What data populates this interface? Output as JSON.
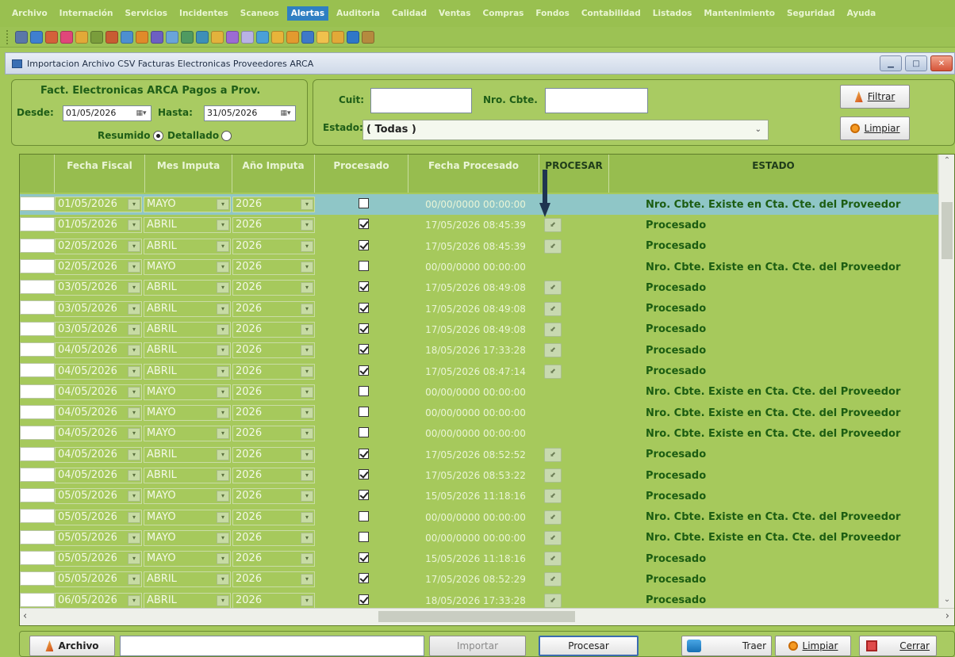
{
  "menu": {
    "items": [
      "Archivo",
      "Internación",
      "Servicios",
      "Incidentes",
      "Scaneos",
      "Alertas",
      "Auditoria",
      "Calidad",
      "Ventas",
      "Compras",
      "Fondos",
      "Contabilidad",
      "Listados",
      "Mantenimiento",
      "Seguridad",
      "Ayuda"
    ],
    "active": "Alertas"
  },
  "toolbar": {
    "icons": [
      "print-icon",
      "document-icon",
      "users-icon",
      "heart-icon",
      "home-icon",
      "grid-icon",
      "chart-icon",
      "report-icon",
      "gear-icon",
      "form-icon",
      "calculator-icon",
      "list-icon",
      "table-icon",
      "pencil-icon",
      "wand-icon",
      "wand-icon",
      "link-icon",
      "folder-icon",
      "alert-icon",
      "refresh-icon",
      "folder-icon",
      "refresh-icon",
      "search-icon",
      "exit-icon"
    ]
  },
  "window": {
    "title": "Importacion Archivo CSV Facturas Electronicas Proveedores ARCA"
  },
  "date_filter": {
    "title": "Fact. Electronicas ARCA Pagos a Prov.",
    "desde_label": "Desde:",
    "desde_value": "01/05/2026",
    "hasta_label": "Hasta:",
    "hasta_value": "31/05/2026",
    "resumido_label": "Resumido",
    "detallado_label": "Detallado",
    "mode": "Resumido"
  },
  "search": {
    "cuit_label": "Cuit:",
    "cuit_value": "",
    "nrocbte_label": "Nro. Cbte.",
    "nrocbte_value": "",
    "estado_label": "Estado:",
    "estado_value": "( Todas )",
    "filtrar_label": "Filtrar",
    "limpiar_label": "Limpiar"
  },
  "grid": {
    "columns": [
      "Fecha Fiscal",
      "Mes Imputa",
      "Año Imputa",
      "Procesado",
      "Fecha Procesado",
      "PROCESAR",
      "ESTADO"
    ],
    "rows": [
      {
        "fecha": "01/05/2026",
        "mes": "MAYO",
        "anio": "2026",
        "procesado": false,
        "fecha_proc": "00/00/0000 00:00:00",
        "procesar": false,
        "estado": "Nro. Cbte. Existe en Cta. Cte. del Proveedor",
        "selected": true
      },
      {
        "fecha": "01/05/2026",
        "mes": "ABRIL",
        "anio": "2026",
        "procesado": true,
        "fecha_proc": "17/05/2026 08:45:39",
        "procesar": true,
        "estado": "Procesado"
      },
      {
        "fecha": "02/05/2026",
        "mes": "ABRIL",
        "anio": "2026",
        "procesado": true,
        "fecha_proc": "17/05/2026 08:45:39",
        "procesar": true,
        "estado": "Procesado"
      },
      {
        "fecha": "02/05/2026",
        "mes": "MAYO",
        "anio": "2026",
        "procesado": false,
        "fecha_proc": "00/00/0000 00:00:00",
        "procesar": false,
        "estado": "Nro. Cbte. Existe en Cta. Cte. del Proveedor"
      },
      {
        "fecha": "03/05/2026",
        "mes": "ABRIL",
        "anio": "2026",
        "procesado": true,
        "fecha_proc": "17/05/2026 08:49:08",
        "procesar": true,
        "estado": "Procesado"
      },
      {
        "fecha": "03/05/2026",
        "mes": "ABRIL",
        "anio": "2026",
        "procesado": true,
        "fecha_proc": "17/05/2026 08:49:08",
        "procesar": true,
        "estado": "Procesado"
      },
      {
        "fecha": "03/05/2026",
        "mes": "ABRIL",
        "anio": "2026",
        "procesado": true,
        "fecha_proc": "17/05/2026 08:49:08",
        "procesar": true,
        "estado": "Procesado"
      },
      {
        "fecha": "04/05/2026",
        "mes": "ABRIL",
        "anio": "2026",
        "procesado": true,
        "fecha_proc": "18/05/2026 17:33:28",
        "procesar": true,
        "estado": "Procesado"
      },
      {
        "fecha": "04/05/2026",
        "mes": "ABRIL",
        "anio": "2026",
        "procesado": true,
        "fecha_proc": "17/05/2026 08:47:14",
        "procesar": true,
        "estado": "Procesado"
      },
      {
        "fecha": "04/05/2026",
        "mes": "MAYO",
        "anio": "2026",
        "procesado": false,
        "fecha_proc": "00/00/0000 00:00:00",
        "procesar": false,
        "estado": "Nro. Cbte. Existe en Cta. Cte. del Proveedor"
      },
      {
        "fecha": "04/05/2026",
        "mes": "MAYO",
        "anio": "2026",
        "procesado": false,
        "fecha_proc": "00/00/0000 00:00:00",
        "procesar": false,
        "estado": "Nro. Cbte. Existe en Cta. Cte. del Proveedor"
      },
      {
        "fecha": "04/05/2026",
        "mes": "MAYO",
        "anio": "2026",
        "procesado": false,
        "fecha_proc": "00/00/0000 00:00:00",
        "procesar": false,
        "estado": "Nro. Cbte. Existe en Cta. Cte. del Proveedor"
      },
      {
        "fecha": "04/05/2026",
        "mes": "ABRIL",
        "anio": "2026",
        "procesado": true,
        "fecha_proc": "17/05/2026 08:52:52",
        "procesar": true,
        "estado": "Procesado"
      },
      {
        "fecha": "04/05/2026",
        "mes": "ABRIL",
        "anio": "2026",
        "procesado": true,
        "fecha_proc": "17/05/2026 08:53:22",
        "procesar": true,
        "estado": "Procesado"
      },
      {
        "fecha": "05/05/2026",
        "mes": "MAYO",
        "anio": "2026",
        "procesado": true,
        "fecha_proc": "15/05/2026 11:18:16",
        "procesar": true,
        "estado": "Procesado"
      },
      {
        "fecha": "05/05/2026",
        "mes": "MAYO",
        "anio": "2026",
        "procesado": false,
        "fecha_proc": "00/00/0000 00:00:00",
        "procesar": true,
        "estado": "Nro. Cbte. Existe en Cta. Cte. del Proveedor"
      },
      {
        "fecha": "05/05/2026",
        "mes": "MAYO",
        "anio": "2026",
        "procesado": false,
        "fecha_proc": "00/00/0000 00:00:00",
        "procesar": true,
        "estado": "Nro. Cbte. Existe en Cta. Cte. del Proveedor"
      },
      {
        "fecha": "05/05/2026",
        "mes": "MAYO",
        "anio": "2026",
        "procesado": true,
        "fecha_proc": "15/05/2026 11:18:16",
        "procesar": true,
        "estado": "Procesado"
      },
      {
        "fecha": "05/05/2026",
        "mes": "ABRIL",
        "anio": "2026",
        "procesado": true,
        "fecha_proc": "17/05/2026 08:52:29",
        "procesar": true,
        "estado": "Procesado"
      },
      {
        "fecha": "06/05/2026",
        "mes": "ABRIL",
        "anio": "2026",
        "procesado": true,
        "fecha_proc": "18/05/2026 17:33:28",
        "procesar": true,
        "estado": "Procesado"
      }
    ]
  },
  "bottom": {
    "archivo_label": "Archivo",
    "archivo_value": "",
    "importar_label": "Importar",
    "procesar_label": "Procesar",
    "traer_label": "Traer",
    "limpiar_label": "Limpiar",
    "cerrar_label": "Cerrar"
  },
  "colors": {
    "background": "#a4c85a",
    "menu_active": "#2f7fc2",
    "selected_row": "#8fc6c7",
    "status_text": "#1c5d12"
  }
}
